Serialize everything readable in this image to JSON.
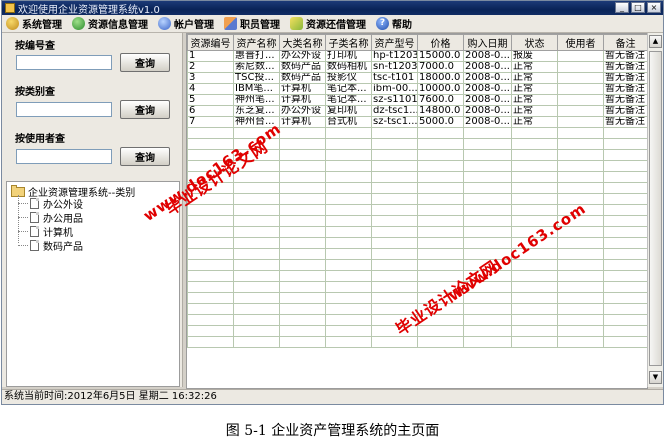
{
  "window": {
    "title": "欢迎使用企业资源管理系统v1.0",
    "controls": [
      "_",
      "□",
      "×"
    ]
  },
  "menu": [
    {
      "label": "系统管理",
      "icon": "system-icon"
    },
    {
      "label": "资源信息管理",
      "icon": "resource-icon"
    },
    {
      "label": "帐户管理",
      "icon": "account-icon"
    },
    {
      "label": "职员管理",
      "icon": "employee-icon"
    },
    {
      "label": "资源还借管理",
      "icon": "return-borrow-icon"
    },
    {
      "label": "帮助",
      "icon": "help-icon"
    }
  ],
  "search": {
    "by_id_label": "按编号查",
    "by_type_label": "按类别查",
    "by_user_label": "按使用者查",
    "button_label": "查询",
    "by_id_value": "",
    "by_type_value": "",
    "by_user_value": ""
  },
  "tree": {
    "root": "企业资源管理系统--类别",
    "children": [
      "办公外设",
      "办公用品",
      "计算机",
      "数码产品"
    ]
  },
  "table": {
    "headers": [
      "资源编号",
      "资产名称",
      "大类名称",
      "子类名称",
      "资产型号",
      "价格",
      "购入日期",
      "状态",
      "使用者",
      "备注"
    ],
    "rows": [
      [
        "1",
        "惠普打...",
        "办公外设",
        "打印机",
        "hp-t1203",
        "15000.0",
        "2008-0...",
        "报废",
        "",
        "暂无备注"
      ],
      [
        "2",
        "索尼数...",
        "数码产品",
        "数码相机",
        "sn-t1203",
        "7000.0",
        "2008-0...",
        "正常",
        "",
        "暂无备注"
      ],
      [
        "3",
        "TSC投...",
        "数码产品",
        "投影仪",
        "tsc-t101",
        "18000.0",
        "2008-0...",
        "正常",
        "",
        "暂无备注"
      ],
      [
        "4",
        "IBM笔...",
        "计算机",
        "笔记本...",
        "ibm-00...",
        "10000.0",
        "2008-0...",
        "正常",
        "",
        "暂无备注"
      ],
      [
        "5",
        "神州笔...",
        "计算机",
        "笔记本...",
        "sz-s1101",
        "7600.0",
        "2008-0...",
        "正常",
        "",
        "暂无备注"
      ],
      [
        "6",
        "东芝复...",
        "办公外设",
        "复印机",
        "dz-tsc1...",
        "14800.0",
        "2008-0...",
        "正常",
        "",
        "暂无备注"
      ],
      [
        "7",
        "神州台...",
        "计算机",
        "台式机",
        "sz-tsc1...",
        "5000.0",
        "2008-0...",
        "正常",
        "",
        "暂无备注"
      ]
    ]
  },
  "status": {
    "text": "系统当前时间:2012年6月5日 星期二 16:32:26"
  },
  "watermarks": {
    "site_name": "毕业设计论文网",
    "site_url": "www.doc163.com"
  },
  "caption": "图 5-1  企业资产管理系统的主页面"
}
